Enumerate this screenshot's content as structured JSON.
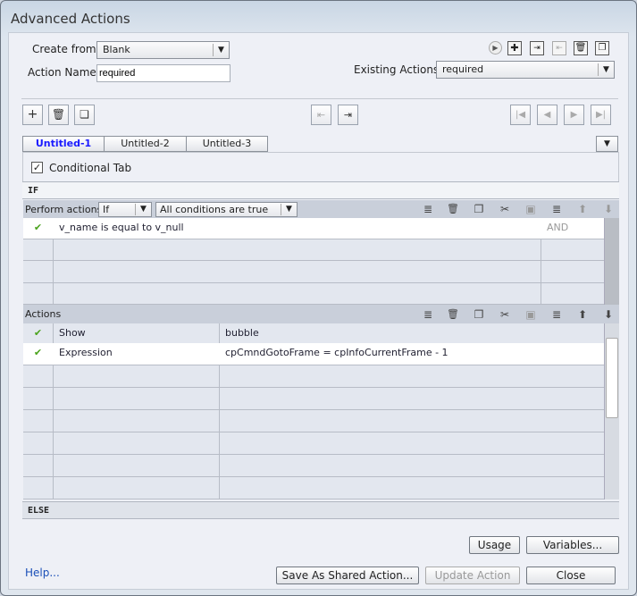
{
  "window": {
    "title": "Advanced Actions"
  },
  "header": {
    "create_from_label": "Create from:",
    "create_from_value": "Blank",
    "action_name_label": "Action Name:",
    "action_name_value": "required",
    "existing_actions_label": "Existing Actions:",
    "existing_actions_value": "required"
  },
  "tabs": [
    {
      "label": "Untitled-1",
      "active": true
    },
    {
      "label": "Untitled-2"
    },
    {
      "label": "Untitled-3"
    }
  ],
  "conditional_tab_label": "Conditional Tab",
  "conditional_tab_checked": true,
  "if_label": "IF",
  "perform": {
    "label": "Perform actions:",
    "mode": "If",
    "condition": "All conditions are true"
  },
  "conditions": [
    {
      "text": "v_name   is equal to   v_null",
      "operator": "AND"
    }
  ],
  "actions_label": "Actions",
  "actions": [
    {
      "action": "Show",
      "target": "bubble"
    },
    {
      "action": "Expression",
      "target": "cpCmndGotoFrame   =   cpInfoCurrentFrame   -   1"
    }
  ],
  "else_label": "ELSE",
  "buttons": {
    "usage": "Usage",
    "variables": "Variables...",
    "help": "Help...",
    "save_shared": "Save As Shared Action...",
    "update": "Update Action",
    "close": "Close"
  },
  "colors": {
    "active_tab": "#1a1aff",
    "check": "#4aa31c"
  }
}
